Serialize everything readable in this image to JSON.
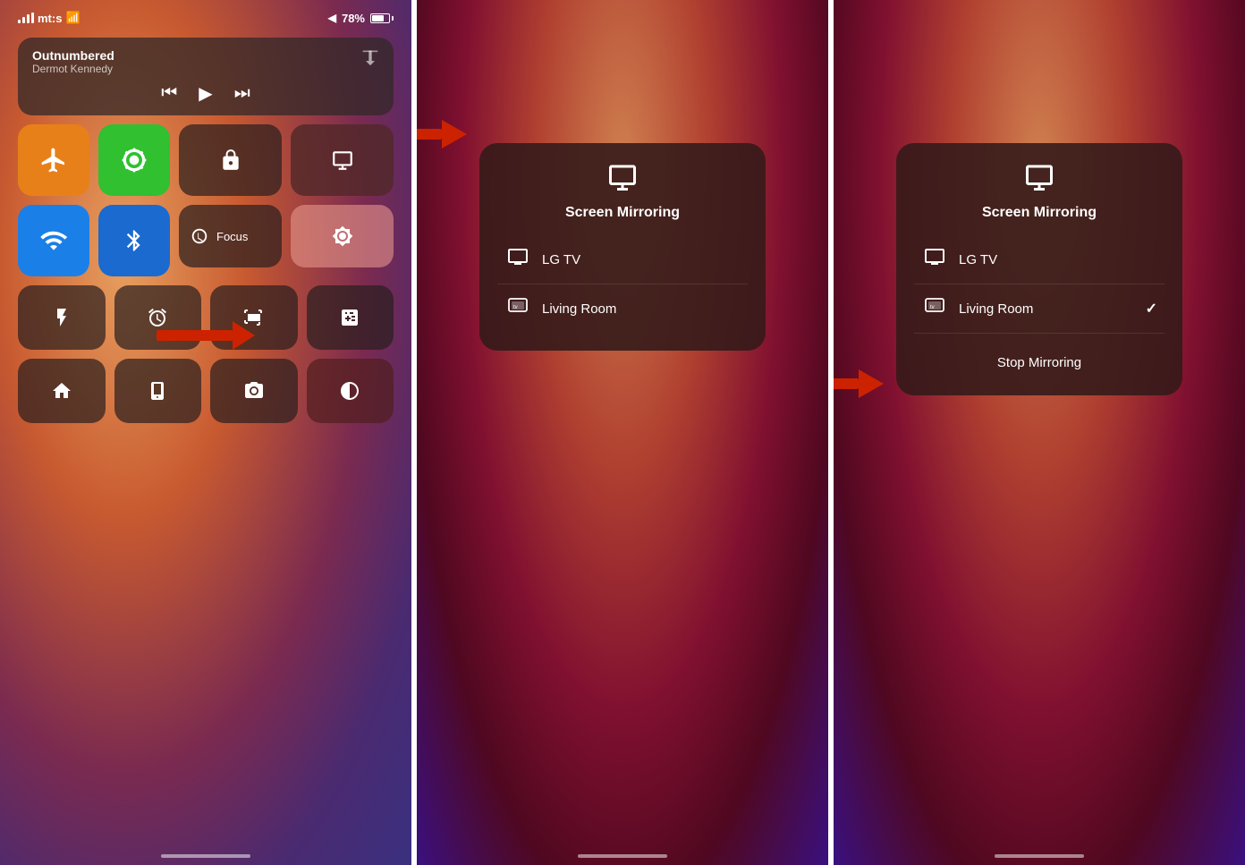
{
  "panels": [
    {
      "id": "panel-1",
      "status": {
        "carrier": "mt:s",
        "wifi": true,
        "battery": "78%",
        "location": true
      },
      "media": {
        "title": "Outnumbered",
        "artist": "Dermot Kennedy",
        "airplay_label": "airplay"
      },
      "toggles": [
        {
          "id": "airplane",
          "icon": "✈",
          "active": true,
          "color": "orange"
        },
        {
          "id": "cellular",
          "icon": "📡",
          "active": true,
          "color": "green"
        },
        {
          "id": "wifi",
          "icon": "wifi",
          "active": true,
          "color": "blue"
        },
        {
          "id": "bluetooth",
          "icon": "bluetooth",
          "active": true,
          "color": "blue2"
        }
      ],
      "second_row": [
        {
          "id": "orientation",
          "icon": "🔄",
          "style": "dark"
        },
        {
          "id": "screen-mirror",
          "icon": "⬜",
          "style": "mirror"
        },
        {
          "id": "brightness",
          "icon": "☀",
          "style": "pink"
        },
        {
          "id": "mute",
          "icon": "🔇",
          "style": "dark-red"
        }
      ],
      "focus_label": "Focus",
      "bottom_icons": [
        {
          "id": "flashlight",
          "icon": "🔦"
        },
        {
          "id": "alarm",
          "icon": "⏰"
        },
        {
          "id": "scan",
          "icon": "📷"
        },
        {
          "id": "calculator",
          "icon": "🧮"
        },
        {
          "id": "home",
          "icon": "🏠"
        },
        {
          "id": "remote",
          "icon": "📺"
        },
        {
          "id": "camera",
          "icon": "📷"
        },
        {
          "id": "contrast",
          "icon": "⬛"
        }
      ]
    },
    {
      "id": "panel-2",
      "popup": {
        "icon": "⬛⬛",
        "title": "Screen Mirroring",
        "devices": [
          {
            "id": "lg-tv",
            "icon": "🖥",
            "name": "LG TV",
            "selected": false
          },
          {
            "id": "living-room",
            "icon": "📺",
            "name": "Living Room",
            "selected": false
          }
        ]
      },
      "arrow_label": "arrow pointing to Screen Mirroring"
    },
    {
      "id": "panel-3",
      "popup": {
        "icon": "⬛⬛",
        "title": "Screen Mirroring",
        "devices": [
          {
            "id": "lg-tv",
            "icon": "🖥",
            "name": "LG TV",
            "selected": false
          },
          {
            "id": "living-room",
            "icon": "📺",
            "name": "Living Room",
            "selected": true
          }
        ],
        "stop_mirroring": "Stop Mirroring"
      },
      "arrow_label": "arrow pointing to Stop Mirroring"
    }
  ]
}
